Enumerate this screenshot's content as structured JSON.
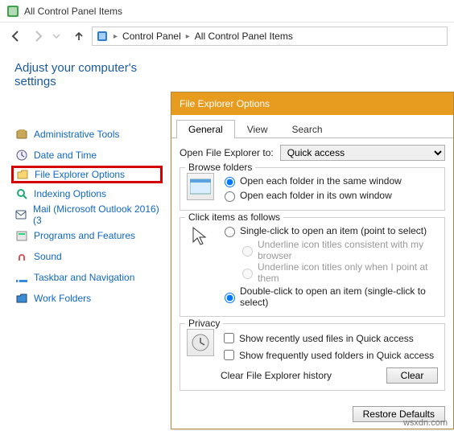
{
  "window_title": "All Control Panel Items",
  "breadcrumb": [
    "Control Panel",
    "All Control Panel Items"
  ],
  "subtitle": "Adjust your computer's settings",
  "cp_items": [
    "Administrative Tools",
    "Date and Time",
    "File Explorer Options",
    "Indexing Options",
    "Mail (Microsoft Outlook 2016) (3",
    "Programs and Features",
    "Sound",
    "Taskbar and Navigation",
    "Work Folders"
  ],
  "highlight_index": 2,
  "dialog": {
    "title": "File Explorer Options",
    "tabs": [
      "General",
      "View",
      "Search"
    ],
    "active_tab": 0,
    "open_label": "Open File Explorer to:",
    "open_value": "Quick access",
    "browse": {
      "title": "Browse folders",
      "opt_same": "Open each folder in the same window",
      "opt_own": "Open each folder in its own window",
      "selected": "same"
    },
    "click": {
      "title": "Click items as follows",
      "single": "Single-click to open an item (point to select)",
      "sub_consistent": "Underline icon titles consistent with my browser",
      "sub_point": "Underline icon titles only when I point at them",
      "double": "Double-click to open an item (single-click to select)",
      "selected": "double"
    },
    "privacy": {
      "title": "Privacy",
      "recent": "Show recently used files in Quick access",
      "frequent": "Show frequently used folders in Quick access",
      "clear_label": "Clear File Explorer history",
      "clear_btn": "Clear"
    },
    "restore_btn": "Restore Defaults"
  },
  "watermark": "wsxdn.com"
}
